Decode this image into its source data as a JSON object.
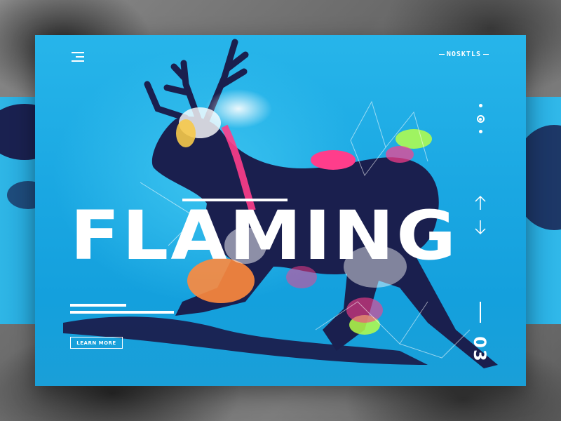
{
  "header": {
    "menu_icon": "hamburger-menu-icon",
    "brand": "NOSKTLS"
  },
  "hero": {
    "title": "FLAMING",
    "cta_label": "LEARN MORE",
    "slide_number": "03"
  },
  "pagination": {
    "dots": 3,
    "active_index": 1
  },
  "navigation": {
    "up_icon": "arrow-up-icon",
    "down_icon": "arrow-down-icon"
  },
  "colors": {
    "card_blue": "#1aa7e2",
    "deer_navy": "#1a1f4e",
    "accent_pink": "#ff3d8b",
    "accent_orange": "#ff8a3d",
    "accent_green": "#b6ff4a",
    "text_white": "#ffffff"
  }
}
